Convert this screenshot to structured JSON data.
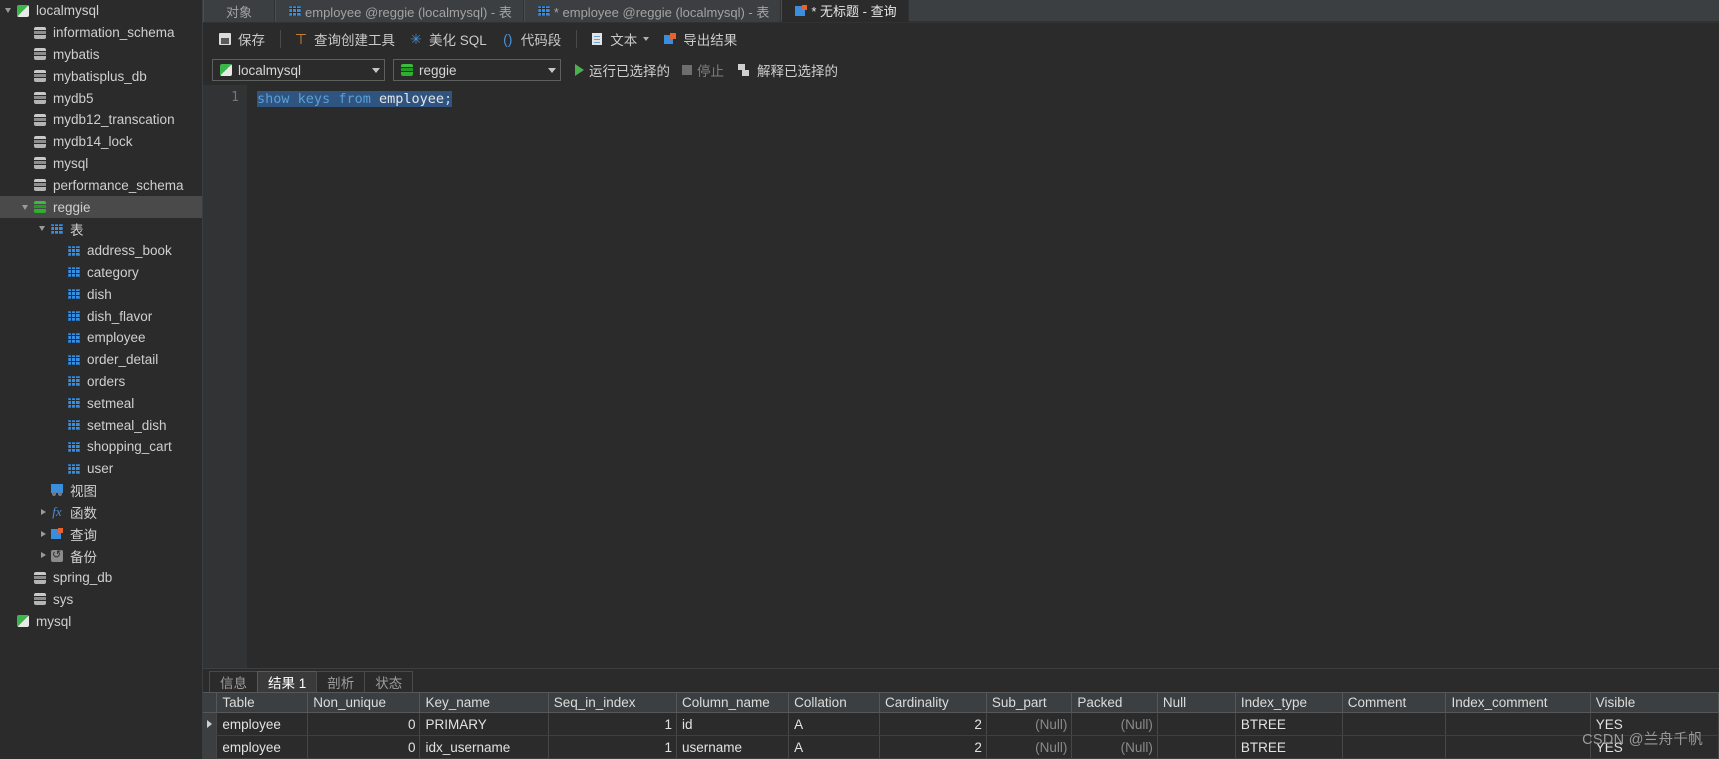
{
  "sidebar": {
    "items": [
      {
        "label": "localmysql",
        "icon": "connection-icon",
        "indent": 0,
        "arrow": "open",
        "selected": false,
        "partial": true
      },
      {
        "label": "information_schema",
        "icon": "database-icon",
        "indent": 1,
        "arrow": "none",
        "selected": false
      },
      {
        "label": "mybatis",
        "icon": "database-icon",
        "indent": 1,
        "arrow": "none",
        "selected": false
      },
      {
        "label": "mybatisplus_db",
        "icon": "database-icon",
        "indent": 1,
        "arrow": "none",
        "selected": false
      },
      {
        "label": "mydb5",
        "icon": "database-icon",
        "indent": 1,
        "arrow": "none",
        "selected": false
      },
      {
        "label": "mydb12_transcation",
        "icon": "database-icon",
        "indent": 1,
        "arrow": "none",
        "selected": false
      },
      {
        "label": "mydb14_lock",
        "icon": "database-icon",
        "indent": 1,
        "arrow": "none",
        "selected": false
      },
      {
        "label": "mysql",
        "icon": "database-icon",
        "indent": 1,
        "arrow": "none",
        "selected": false
      },
      {
        "label": "performance_schema",
        "icon": "database-icon",
        "indent": 1,
        "arrow": "none",
        "selected": false
      },
      {
        "label": "reggie",
        "icon": "database-green-icon",
        "indent": 1,
        "arrow": "open",
        "selected": true
      },
      {
        "label": "表",
        "icon": "table-icon",
        "indent": 2,
        "arrow": "open",
        "selected": false
      },
      {
        "label": "address_book",
        "icon": "table-icon",
        "indent": 3,
        "arrow": "none",
        "selected": false
      },
      {
        "label": "category",
        "icon": "table-icon",
        "indent": 3,
        "arrow": "none",
        "selected": false
      },
      {
        "label": "dish",
        "icon": "table-icon",
        "indent": 3,
        "arrow": "none",
        "selected": false
      },
      {
        "label": "dish_flavor",
        "icon": "table-icon",
        "indent": 3,
        "arrow": "none",
        "selected": false
      },
      {
        "label": "employee",
        "icon": "table-icon",
        "indent": 3,
        "arrow": "none",
        "selected": false
      },
      {
        "label": "order_detail",
        "icon": "table-icon",
        "indent": 3,
        "arrow": "none",
        "selected": false
      },
      {
        "label": "orders",
        "icon": "table-icon",
        "indent": 3,
        "arrow": "none",
        "selected": false
      },
      {
        "label": "setmeal",
        "icon": "table-icon",
        "indent": 3,
        "arrow": "none",
        "selected": false
      },
      {
        "label": "setmeal_dish",
        "icon": "table-icon",
        "indent": 3,
        "arrow": "none",
        "selected": false
      },
      {
        "label": "shopping_cart",
        "icon": "table-icon",
        "indent": 3,
        "arrow": "none",
        "selected": false
      },
      {
        "label": "user",
        "icon": "table-icon",
        "indent": 3,
        "arrow": "none",
        "selected": false
      },
      {
        "label": "视图",
        "icon": "view-icon",
        "indent": 2,
        "arrow": "none",
        "selected": false
      },
      {
        "label": "函数",
        "icon": "function-icon",
        "indent": 2,
        "arrow": "closed",
        "selected": false
      },
      {
        "label": "查询",
        "icon": "query-icon",
        "indent": 2,
        "arrow": "closed",
        "selected": false
      },
      {
        "label": "备份",
        "icon": "backup-icon",
        "indent": 2,
        "arrow": "closed",
        "selected": false
      },
      {
        "label": "spring_db",
        "icon": "database-icon",
        "indent": 1,
        "arrow": "none",
        "selected": false
      },
      {
        "label": "sys",
        "icon": "database-icon",
        "indent": 1,
        "arrow": "none",
        "selected": false
      },
      {
        "label": "mysql",
        "icon": "connection-icon",
        "indent": 0,
        "arrow": "none",
        "selected": false
      }
    ]
  },
  "tabstrip": {
    "tabs": [
      {
        "label": "对象",
        "icon": "none",
        "active": false
      },
      {
        "label": "employee @reggie (localmysql) - 表",
        "icon": "table-icon",
        "active": false
      },
      {
        "label": "* employee @reggie (localmysql) - 表",
        "icon": "table-edit-icon",
        "active": false
      },
      {
        "label": "* 无标题 - 查询",
        "icon": "query-icon",
        "active": true
      }
    ]
  },
  "toolbar": {
    "save_label": "保存",
    "query_builder_label": "查询创建工具",
    "beautify_sql_label": "美化 SQL",
    "snippet_label": "代码段",
    "text_label": "文本",
    "export_result_label": "导出结果"
  },
  "connbar": {
    "connection_value": "localmysql",
    "database_value": "reggie",
    "run_selected_label": "运行已选择的",
    "stop_label": "停止",
    "explain_selected_label": "解释已选择的"
  },
  "editor": {
    "line_number": "1",
    "sql_tokens": [
      {
        "t": "show",
        "c": "kw"
      },
      {
        "t": " ",
        "c": "punct"
      },
      {
        "t": "keys",
        "c": "kw"
      },
      {
        "t": " ",
        "c": "punct"
      },
      {
        "t": "from",
        "c": "kw"
      },
      {
        "t": " ",
        "c": "punct"
      },
      {
        "t": "employee",
        "c": "id"
      },
      {
        "t": ";",
        "c": "punct"
      }
    ],
    "sql_text": "show keys from employee;"
  },
  "results": {
    "tabs": [
      {
        "label": "信息",
        "active": false
      },
      {
        "label": "结果 1",
        "active": true
      },
      {
        "label": "剖析",
        "active": false
      },
      {
        "label": "状态",
        "active": false
      }
    ],
    "columns": [
      "Table",
      "Non_unique",
      "Key_name",
      "Seq_in_index",
      "Column_name",
      "Collation",
      "Cardinality",
      "Sub_part",
      "Packed",
      "Null",
      "Index_type",
      "Comment",
      "Index_comment",
      "Visible"
    ],
    "rows": [
      {
        "current": true,
        "cells": [
          {
            "v": "employee",
            "align": "left"
          },
          {
            "v": "0",
            "align": "right"
          },
          {
            "v": "PRIMARY",
            "align": "left"
          },
          {
            "v": "1",
            "align": "right"
          },
          {
            "v": "id",
            "align": "left"
          },
          {
            "v": "A",
            "align": "left"
          },
          {
            "v": "2",
            "align": "right"
          },
          {
            "v": "(Null)",
            "align": "null"
          },
          {
            "v": "(Null)",
            "align": "null"
          },
          {
            "v": "",
            "align": "left"
          },
          {
            "v": "BTREE",
            "align": "left"
          },
          {
            "v": "",
            "align": "left"
          },
          {
            "v": "",
            "align": "left"
          },
          {
            "v": "YES",
            "align": "left"
          }
        ]
      },
      {
        "current": false,
        "cells": [
          {
            "v": "employee",
            "align": "left"
          },
          {
            "v": "0",
            "align": "right"
          },
          {
            "v": "idx_username",
            "align": "left"
          },
          {
            "v": "1",
            "align": "right"
          },
          {
            "v": "username",
            "align": "left"
          },
          {
            "v": "A",
            "align": "left"
          },
          {
            "v": "2",
            "align": "right"
          },
          {
            "v": "(Null)",
            "align": "null"
          },
          {
            "v": "(Null)",
            "align": "null"
          },
          {
            "v": "",
            "align": "left"
          },
          {
            "v": "BTREE",
            "align": "left"
          },
          {
            "v": "",
            "align": "left"
          },
          {
            "v": "",
            "align": "left"
          },
          {
            "v": "YES",
            "align": "left"
          }
        ]
      }
    ]
  },
  "watermark": {
    "text": "CSDN @兰舟千帆"
  },
  "colors": {
    "background": "#2b2b2b",
    "panel": "#3c3f41",
    "selection": "#2f5480",
    "keyword": "#5b9fd6",
    "accent_green": "#4caf50",
    "accent_blue": "#3a8ede",
    "accent_orange": "#e8622a"
  }
}
